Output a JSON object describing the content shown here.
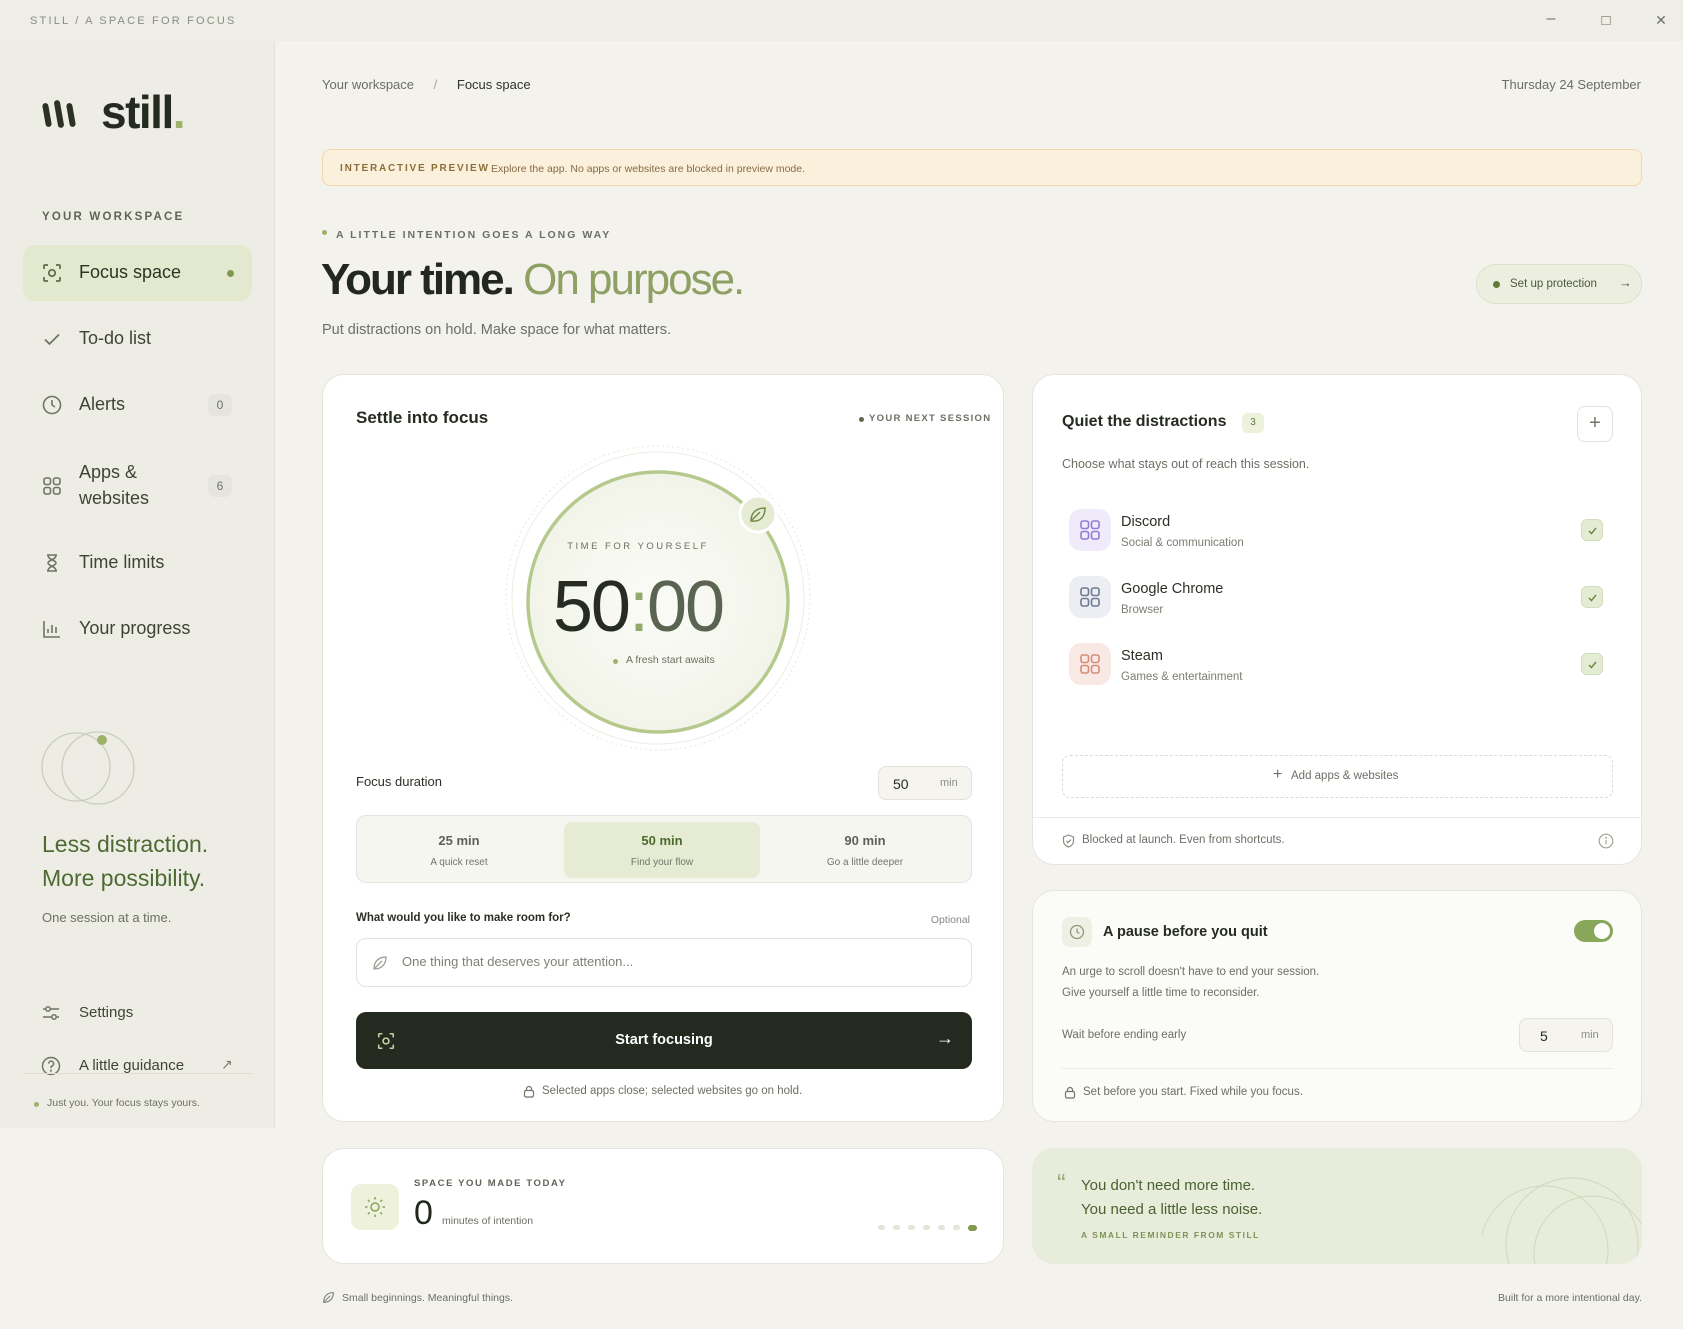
{
  "window": {
    "title": "STILL / A SPACE FOR FOCUS",
    "minimize": "–",
    "maximize": "□",
    "close": "✕"
  },
  "brand": {
    "name": "still",
    "dot": "."
  },
  "sidebar": {
    "section_label": "YOUR WORKSPACE",
    "items": [
      {
        "label": "Focus space",
        "icon": "focus-frame-icon",
        "active": true
      },
      {
        "label": "To-do list",
        "icon": "check-icon"
      },
      {
        "label": "Alerts",
        "icon": "clock-icon",
        "badge": "0"
      },
      {
        "label": "Apps &\nwebsites",
        "icon": "grid-icon",
        "badge": "6"
      },
      {
        "label": "Time limits",
        "icon": "hourglass-icon"
      },
      {
        "label": "Your progress",
        "icon": "chart-icon"
      }
    ],
    "promo_line1": "Less distraction.",
    "promo_line2": "More possibility.",
    "promo_sub": "One session at a time.",
    "settings": "Settings",
    "guidance": "A little guidance",
    "footer": "Just you. Your focus stays yours."
  },
  "header": {
    "breadcrumb_root": "Your workspace",
    "breadcrumb_sep": "/",
    "breadcrumb_current": "Focus space",
    "date": "Thursday 24 September"
  },
  "banner": {
    "label": "INTERACTIVE PREVIEW",
    "text": "Explore the app. No apps or websites are blocked in preview mode."
  },
  "hero": {
    "kicker": "A LITTLE INTENTION GOES A LONG WAY",
    "title_dark": "Your time.",
    "title_light": "On purpose.",
    "subtitle": "Put distractions on hold. Make space for what matters.",
    "cta": "Set up protection"
  },
  "focus_card": {
    "title": "Settle into focus",
    "next_session": "YOUR NEXT SESSION",
    "timer_label": "TIME FOR YOURSELF",
    "timer_minutes": "50",
    "timer_colon": ":",
    "timer_seconds": "00",
    "timer_status": "A fresh start awaits",
    "duration_label": "Focus duration",
    "duration_value": "50",
    "duration_unit": "min",
    "presets": [
      {
        "time": "25 min",
        "desc": "A quick reset"
      },
      {
        "time": "50 min",
        "desc": "Find your flow",
        "selected": true
      },
      {
        "time": "90 min",
        "desc": "Go a little deeper"
      }
    ],
    "intention_label": "What would you like to make room for?",
    "intention_optional": "Optional",
    "intention_placeholder": "One thing that deserves your attention...",
    "start_button": "Start focusing",
    "footnote": "Selected apps close; selected websites go on hold."
  },
  "distractions_card": {
    "title": "Quiet the distractions",
    "count": "3",
    "subtitle": "Choose what stays out of reach this session.",
    "apps": [
      {
        "name": "Discord",
        "category": "Social & communication",
        "color": "#efebfb",
        "icon_color": "#8e7fd4"
      },
      {
        "name": "Google Chrome",
        "category": "Browser",
        "color": "#eceef3",
        "icon_color": "#6f7a93"
      },
      {
        "name": "Steam",
        "category": "Games & entertainment",
        "color": "#f8e9e4",
        "icon_color": "#d58d7b"
      }
    ],
    "add_label": "Add apps & websites",
    "footer": "Blocked at launch. Even from shortcuts."
  },
  "pause_card": {
    "title": "A pause before you quit",
    "toggle_on": true,
    "desc_line1": "An urge to scroll doesn't have to end your session.",
    "desc_line2": "Give yourself a little time to reconsider.",
    "wait_label": "Wait before ending early",
    "wait_value": "5",
    "wait_unit": "min",
    "footer": "Set before you start. Fixed while you focus."
  },
  "today_card": {
    "label": "SPACE YOU MADE TODAY",
    "value": "0",
    "unit": "minutes of intention",
    "week_dots": 7,
    "active_dot_index": 6
  },
  "quote_card": {
    "mark": "“",
    "line1": "You don't need more time.",
    "line2": "You need a little less noise.",
    "attribution": "A SMALL REMINDER FROM STILL"
  },
  "footer": {
    "left": "Small beginnings. Meaningful things.",
    "right": "Built for a more intentional day."
  },
  "colors": {
    "accent_green": "#a8bf78",
    "dark_button": "#242a20",
    "banner_bg": "#fbf0dc",
    "toggle_green": "#88a75a"
  }
}
